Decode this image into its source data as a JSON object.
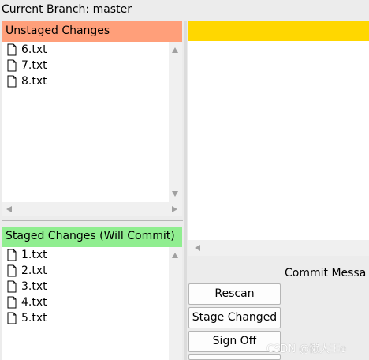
{
  "branch": {
    "text": "Current Branch: master"
  },
  "colors": {
    "unstaged_header": "#ff9f7a",
    "staged_header": "#90ee90",
    "diff_header": "#ffd700"
  },
  "unstaged": {
    "header": "Unstaged Changes",
    "files": [
      "6.txt",
      "7.txt",
      "8.txt"
    ]
  },
  "staged": {
    "header": "Staged Changes (Will Commit)",
    "files": [
      "1.txt",
      "2.txt",
      "3.txt",
      "4.txt",
      "5.txt"
    ]
  },
  "commit": {
    "label": "Commit Messa",
    "buttons": {
      "rescan": "Rescan",
      "stage": "Stage Changed",
      "signoff": "Sign Off"
    }
  },
  "watermark": "CSDN @懒大王o"
}
